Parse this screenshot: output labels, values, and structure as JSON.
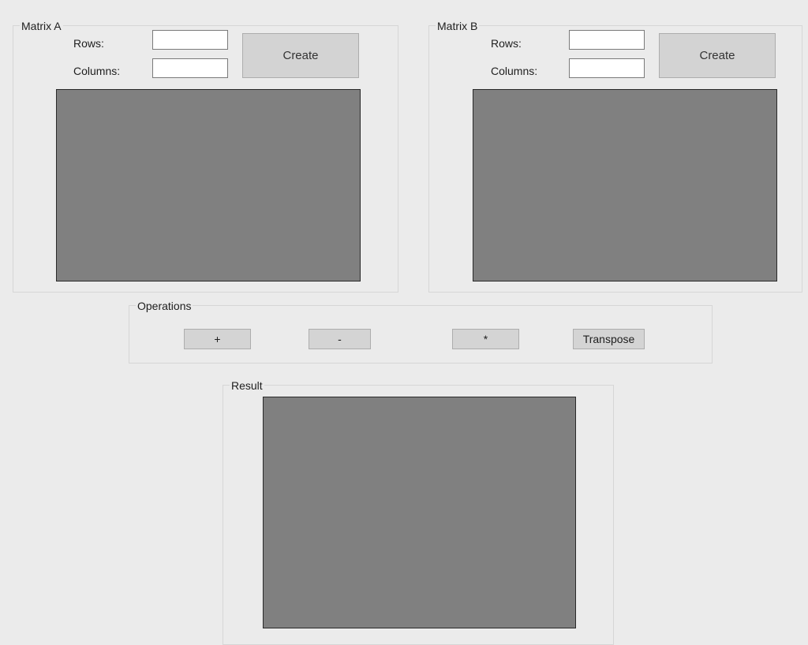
{
  "matrix_a": {
    "title": "Matrix A",
    "rows_label": "Rows:",
    "columns_label": "Columns:",
    "rows_value": "",
    "columns_value": "",
    "create_label": "Create"
  },
  "matrix_b": {
    "title": "Matrix B",
    "rows_label": "Rows:",
    "columns_label": "Columns:",
    "rows_value": "",
    "columns_value": "",
    "create_label": "Create"
  },
  "operations": {
    "title": "Operations",
    "add_label": "+",
    "subtract_label": "-",
    "multiply_label": "*",
    "transpose_label": "Transpose"
  },
  "result": {
    "title": "Result"
  },
  "colors": {
    "background": "#ebebeb",
    "panel_fill": "#808080",
    "button_fill": "#d3d3d3"
  }
}
